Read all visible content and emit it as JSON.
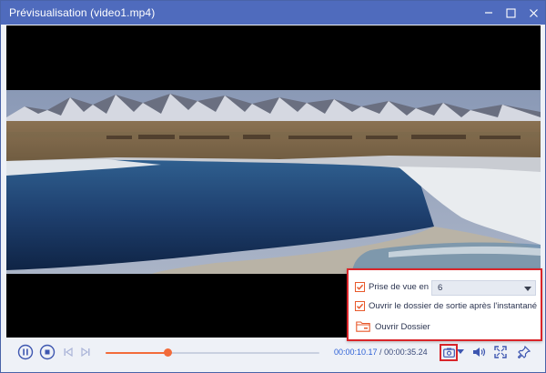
{
  "window": {
    "title": "Prévisualisation (video1.mp4)",
    "controls": [
      "minimize-icon",
      "maximize-icon",
      "close-icon"
    ]
  },
  "player": {
    "current_time": "00:00:10.17",
    "separator": " / ",
    "total_time": "00:00:35.24",
    "progress_fraction": 0.29
  },
  "snapshot_menu": {
    "continuous_label": "Prise de vue en continu",
    "continuous_checked": true,
    "count_value": "6",
    "open_output_label": "Ouvrir le dossier de sortie après l'instantané",
    "open_output_checked": true,
    "open_folder_label": "Ouvrir Dossier"
  },
  "colors": {
    "titlebar": "#4f6bbd",
    "accent": "#f26b3a",
    "time_text": "#2b5fd6",
    "highlight": "#d9252a"
  }
}
